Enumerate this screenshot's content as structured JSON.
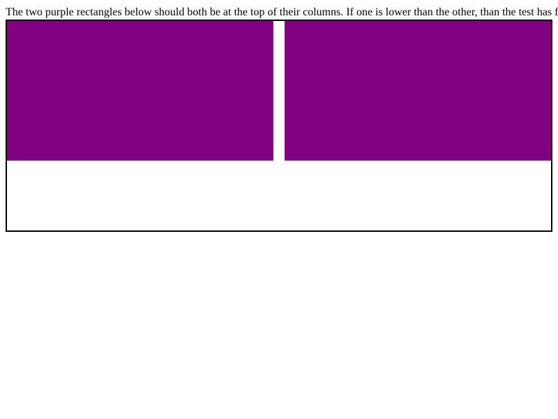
{
  "instructions": {
    "text": "The two purple rectangles below should both be at the top of their columns. If one is lower than the other, than the test has failed."
  },
  "columns": [
    {
      "name": "left-column",
      "rect_color": "#800080"
    },
    {
      "name": "right-column",
      "rect_color": "#800080"
    }
  ],
  "colors": {
    "border": "#000000",
    "background": "#ffffff"
  }
}
